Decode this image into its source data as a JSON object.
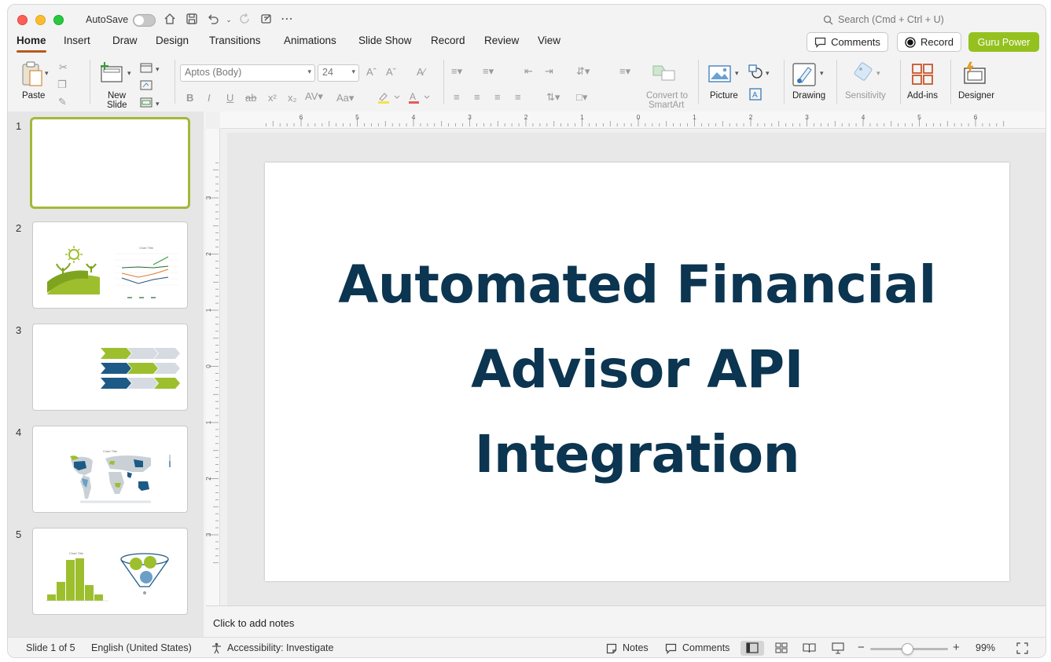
{
  "titlebar": {
    "autosave_label": "AutoSave",
    "search_placeholder": "Search (Cmd + Ctrl + U)"
  },
  "tabs": [
    "Home",
    "Insert",
    "Draw",
    "Design",
    "Transitions",
    "Animations",
    "Slide Show",
    "Record",
    "Review",
    "View"
  ],
  "active_tab": "Home",
  "top_buttons": {
    "comments": "Comments",
    "record": "Record",
    "guru_power": "Guru Power"
  },
  "ribbon": {
    "paste": "Paste",
    "new_slide_line1": "New",
    "new_slide_line2": "Slide",
    "font_name": "Aptos (Body)",
    "font_size": "24",
    "convert_line1": "Convert to",
    "convert_line2": "SmartArt",
    "picture": "Picture",
    "drawing": "Drawing",
    "sensitivity": "Sensitivity",
    "addins": "Add-ins",
    "designer": "Designer"
  },
  "thumbnails": [
    {
      "number": "1"
    },
    {
      "number": "2"
    },
    {
      "number": "3"
    },
    {
      "number": "4"
    },
    {
      "number": "5"
    }
  ],
  "thumb_texts": {
    "chart_title": "Chart Title"
  },
  "ruler": {
    "horizontal": [
      "6",
      "5",
      "4",
      "3",
      "2",
      "1",
      "0",
      "1",
      "2",
      "3",
      "4",
      "5",
      "6"
    ],
    "vertical": [
      "3",
      "2",
      "1",
      "0",
      "1",
      "2",
      "3"
    ]
  },
  "slide": {
    "title_line1": "Automated Financial",
    "title_line2": "Advisor API",
    "title_line3": "Integration"
  },
  "notes_placeholder": "Click to add notes",
  "status": {
    "slide_info": "Slide 1 of 5",
    "language": "English (United States)",
    "accessibility": "Accessibility: Investigate",
    "notes": "Notes",
    "comments": "Comments",
    "zoom": "99%"
  },
  "colors": {
    "accent_green": "#95c11f",
    "title_navy": "#0b3550",
    "tab_underline": "#b85a1e",
    "slide_border_selected": "#a4b83a"
  }
}
